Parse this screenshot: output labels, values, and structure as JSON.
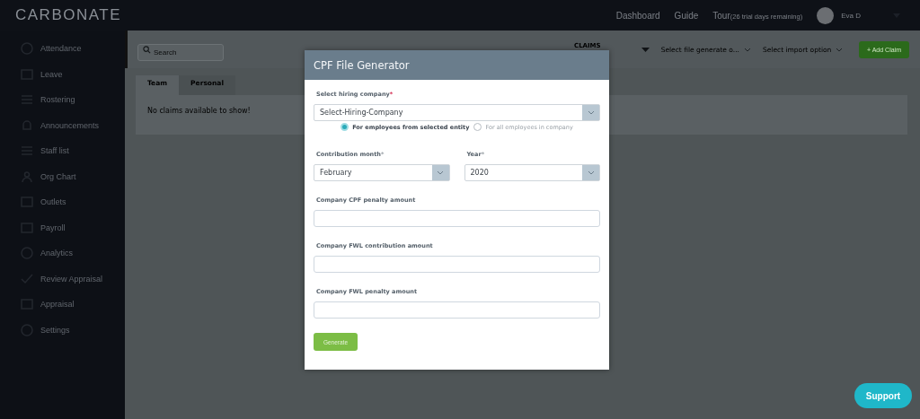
{
  "brand": "CARBONATE",
  "top_nav": [
    {
      "label": "Dashboard"
    },
    {
      "label": "Guide"
    },
    {
      "label": "Tour",
      "note": "(26 trial days remaining)"
    }
  ],
  "user": {
    "name": "Eva D"
  },
  "sidebar": {
    "items": [
      {
        "label": "Attendance"
      },
      {
        "label": "Leave"
      },
      {
        "label": "Rostering"
      },
      {
        "label": "Announcements"
      },
      {
        "label": "Staff list"
      },
      {
        "label": "Org Chart"
      },
      {
        "label": "Outlets"
      },
      {
        "label": "Payroll"
      },
      {
        "label": "Analytics"
      },
      {
        "label": "Review Appraisal"
      },
      {
        "label": "Appraisal"
      },
      {
        "label": "Settings"
      }
    ]
  },
  "toolbar": {
    "search_placeholder": "Search",
    "section": "CLAIMS",
    "file_generate": "Select file generate o...",
    "import_option": "Select import option",
    "add_button": "+ Add Claim"
  },
  "tabs": [
    {
      "label": "Team",
      "selected": true
    },
    {
      "label": "Personal",
      "selected": false
    }
  ],
  "empty_message": "No claims available to show!",
  "dialog": {
    "title": "CPF File Generator",
    "company": {
      "label": "Select hiring company",
      "required_mark": "*",
      "value": "Select-Hiring-Company"
    },
    "scope_options": [
      {
        "label": "For employees from selected entity",
        "selected": true
      },
      {
        "label": "For all employees in company",
        "selected": false
      }
    ],
    "month": {
      "label": "Contribution month",
      "required_mark": "*",
      "value": "February"
    },
    "year": {
      "label": "Year",
      "required_mark": "*",
      "value": "2020"
    },
    "amount_fields": [
      {
        "label": "Company CPF penalty amount"
      },
      {
        "label": "Company FWL contribution amount"
      },
      {
        "label": "Company FWL penalty amount"
      }
    ],
    "submit": "Generate"
  },
  "support": "Support"
}
